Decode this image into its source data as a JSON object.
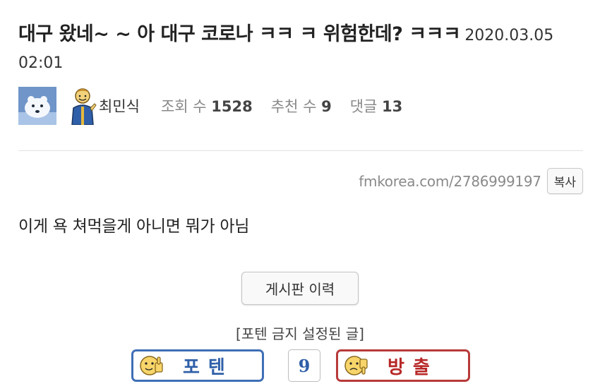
{
  "post": {
    "title": "대구 왔네~ ~ 아 대구 코로나 ㅋㅋ ㅋ 위험한데? ㅋㅋㅋ",
    "date": "2020.03.05 02:01",
    "author": "최민식",
    "views_label": "조회 수",
    "views": "1528",
    "recommend_label": "추천 수",
    "recommend": "9",
    "comments_label": "댓글",
    "comments": "13",
    "url": "fmkorea.com/2786999197",
    "copy_label": "복사",
    "body": "이게 욕 쳐먹을게 아니면 뭐가 아님"
  },
  "actions": {
    "history_label": "게시판 이력",
    "notice": "[포텐 금지 설정된 글]",
    "vote_up_label": "포텐",
    "vote_count": "9",
    "vote_down_label": "방출"
  },
  "icons": {
    "avatar": "polar-bear-avatar-icon",
    "level": "vault-boy-level-icon",
    "vote_up": "thumbs-up-emoji-icon",
    "vote_down": "thumbs-down-emoji-icon"
  },
  "colors": {
    "vote_up": "#2f5fa8",
    "vote_down": "#b72828",
    "meta_label": "#888888"
  }
}
